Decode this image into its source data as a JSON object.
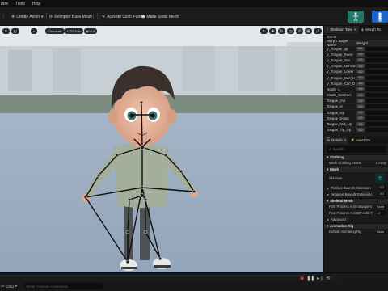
{
  "menubar": {
    "items": [
      "dow",
      "Tools",
      "Help"
    ]
  },
  "toolbar": {
    "create_asset": "Create Asset",
    "reimport": "Reimport Base Mesh",
    "activate_cloth": "Activate Cloth Paint",
    "make_static": "Make Static Mesh",
    "mode_colors": [
      "#1f7a6a",
      "#1e64c8"
    ]
  },
  "viewport": {
    "pills": [
      "",
      "Character",
      "LOD Auto",
      "VL0"
    ]
  },
  "skeleton_panel": {
    "tab_skeleton": "Skeleton Tree",
    "tab_morph": "Morph Ta",
    "search_label": "Tarnitt",
    "col_name": "Morph Target Name",
    "col_weight": "Weight",
    "rows": [
      {
        "name": "V_Tongue_up",
        "weight": "0.0"
      },
      {
        "name": "V_Tongue_Raise",
        "weight": "0.0"
      },
      {
        "name": "V_Tongue_Out",
        "weight": "0.0"
      },
      {
        "name": "V_Tongue_Narrow",
        "weight": "0.0"
      },
      {
        "name": "V_Tongue_Lower",
        "weight": "0.0"
      },
      {
        "name": "V_Tongue_Curl_U",
        "weight": "0.0"
      },
      {
        "name": "V_Tongue_Curl_D",
        "weight": "0.0"
      },
      {
        "name": "Mouth_L",
        "weight": "0.0"
      },
      {
        "name": "Mouth_Contract",
        "weight": "0.0"
      },
      {
        "name": "Tongue_Out",
        "weight": "0.0"
      },
      {
        "name": "Tongue_in",
        "weight": "0.0"
      },
      {
        "name": "Tongue_Up",
        "weight": "0.0"
      },
      {
        "name": "Tongue_Down",
        "weight": "0.0"
      },
      {
        "name": "Tongue_Mid_Up",
        "weight": "0.0"
      },
      {
        "name": "Tongue_Tip_Up",
        "weight": "0.0"
      }
    ]
  },
  "details": {
    "tab_details": "Details",
    "tab_asset": "Asset De",
    "search_placeholder": "Search",
    "clothing_header": "Clothing",
    "clothing_assets": "Mesh Clothing Assets",
    "clothing_value": "0 Array",
    "mesh_header": "Mesh",
    "skeleton_label": "Skeleton",
    "positive_bounds": "Positive Bounds Extension",
    "positive_value": "0.0",
    "negative_bounds": "Negative Bounds Extension",
    "negative_value": "0.0",
    "skeletal_mesh_header": "Skeletal Mesh",
    "post_process": "Post Process Anim Blueprint",
    "post_process_value": "None",
    "post_process_lod": "Post Process AnimBP LOD T",
    "post_process_lod_value": "-1",
    "advanced": "Advanced",
    "anim_rig_header": "Animation Rig",
    "default_rig": "Default Animating Rig",
    "default_rig_value": "None"
  },
  "bottom": {
    "cmd_label": "Cmd",
    "cmd_placeholder": "Enter Console Command"
  }
}
